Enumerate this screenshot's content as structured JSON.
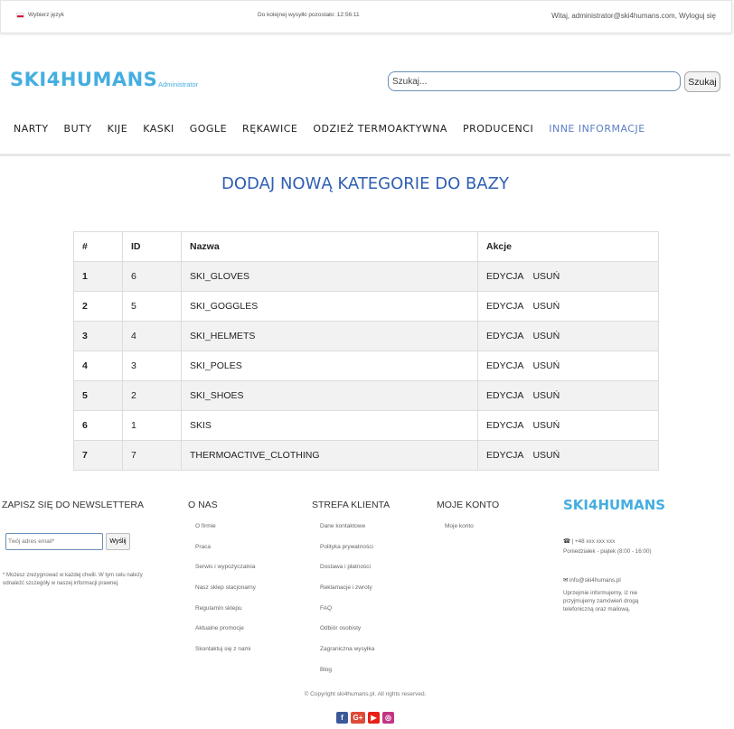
{
  "topbar": {
    "language": "Wybierz język",
    "countdown": "Do kolejnej wysyłki pozostało: 12:56:11",
    "welcome": "Witaj, administrator@ski4humans.com, Wyloguj się"
  },
  "header": {
    "logo": "SKI4HUMANS",
    "logo_sub": "Administrator",
    "search_placeholder": "Szukaj...",
    "search_button": "Szukaj"
  },
  "nav": [
    "NARTY",
    "BUTY",
    "KIJE",
    "KASKI",
    "GOGLE",
    "RĘKAWICE",
    "ODZIEŻ TERMOAKTYWNA",
    "PRODUCENCI",
    "INNE INFORMACJE"
  ],
  "main": {
    "title": "DODAJ NOWĄ KATEGORIE DO BAZY",
    "table": {
      "headers": [
        "#",
        "ID",
        "Nazwa",
        "Akcje"
      ],
      "action_edit": "EDYCJA",
      "action_delete": "USUŃ",
      "rows": [
        {
          "num": "1",
          "id": "6",
          "name": "SKI_GLOVES"
        },
        {
          "num": "2",
          "id": "5",
          "name": "SKI_GOGGLES"
        },
        {
          "num": "3",
          "id": "4",
          "name": "SKI_HELMETS"
        },
        {
          "num": "4",
          "id": "3",
          "name": "SKI_POLES"
        },
        {
          "num": "5",
          "id": "2",
          "name": "SKI_SHOES"
        },
        {
          "num": "6",
          "id": "1",
          "name": "SKIS"
        },
        {
          "num": "7",
          "id": "7",
          "name": "THERMOACTIVE_CLOTHING"
        }
      ]
    }
  },
  "footer": {
    "newsletter": {
      "title": "ZAPISZ SIĘ DO NEWSLETTERA",
      "placeholder": "Twój adres email*",
      "button": "Wyślij",
      "note": "* Możesz zrezygnować w każdej chwili. W tym celu należy odnaleźć szczegóły w naszej informacji prawnej."
    },
    "onas": {
      "title": "O NAS",
      "items": [
        "O firmie",
        "Praca",
        "Serwis i wypożyczalnia",
        "Nasz sklep stacjonarny",
        "Regulamin sklepu",
        "Aktualne promocje",
        "Skontaktuj się z nami"
      ]
    },
    "strefa": {
      "title": "STREFA KLIENTA",
      "items": [
        "Dane kontaktowe",
        "Polityka prywatności",
        "Dostawa i płatności",
        "Reklamacje i zwroty",
        "FAQ",
        "Odbiór osobisty",
        "Zagraniczna wysyłka",
        "Blog"
      ]
    },
    "konto": {
      "title": "MOJE KONTO",
      "items": [
        "Moje konto"
      ]
    },
    "logo": "SKI4HUMANS",
    "phone": "| +48 xxx xxx xxx",
    "hours": "Poniedziałek - piątek (8:00 - 16:00)",
    "email": "info@ski4humans.pl",
    "info": "Uprzejmie informujemy, iż nie przyjmujemy zamówień drogą telefoniczną oraz mailową.",
    "copyright": "© Copyright ski4humans.pl. All rights reserved.",
    "social": [
      "facebook-icon",
      "google-plus-icon",
      "youtube-icon",
      "instagram-icon"
    ],
    "social_colors": [
      "#3b5998",
      "#dd4b39",
      "#e62117",
      "#c13584"
    ]
  }
}
